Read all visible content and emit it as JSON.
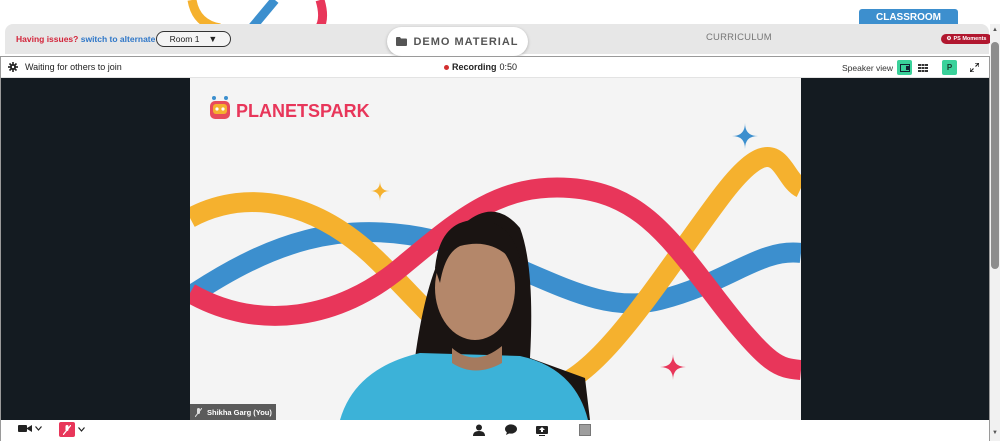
{
  "header": {
    "classroom_tab": "CLASSROOM",
    "issues_text": "Having issues?",
    "switch_link": "switch to alternate room",
    "room_select": {
      "value": "Room 1",
      "arrow": "▼"
    },
    "demo_material": "DEMO MATERIAL",
    "curriculum": "CURRICULUM",
    "ps_moments": "PS Moments"
  },
  "meeting": {
    "status": "Waiting for others to join",
    "recording_label": "Recording",
    "recording_time": "0:50",
    "view_label": "Speaker view",
    "participant_initial": "P",
    "slide": {
      "logo_text": "PLANETSPARK"
    },
    "self_name": "Shikha Garg (You)"
  },
  "colors": {
    "brand_blue": "#3d8fce",
    "alert_red": "#d3243a",
    "link_blue": "#2f77c8",
    "active_green": "#3ad19a",
    "wave_red": "#e8365a",
    "wave_yellow": "#f5b12e",
    "wave_blue": "#3c8fce",
    "stage_dark": "#141b21"
  },
  "icons": [
    "folder-icon",
    "gear-icon",
    "recording-dot-icon",
    "speaker-view-icon",
    "grid-view-icon",
    "expand-icon",
    "camera-icon",
    "chevron-down-icon",
    "mic-muted-icon",
    "participants-icon",
    "chat-icon",
    "share-screen-icon",
    "stop-square-icon",
    "mic-off-icon"
  ]
}
